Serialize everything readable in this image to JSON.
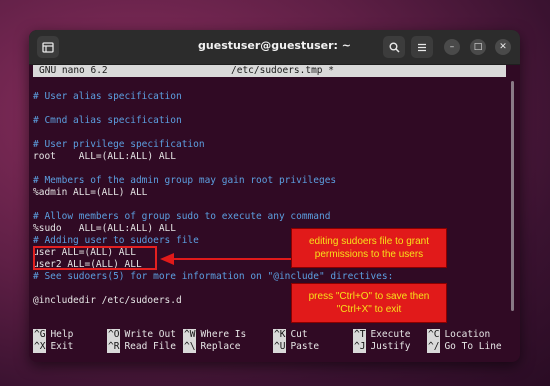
{
  "window": {
    "title": "guestuser@guestuser: ~",
    "new_tab_icon": "new-tab-icon",
    "search_icon": "search-icon",
    "menu_icon": "hamburger-menu-icon",
    "minimize_glyph": "–",
    "maximize_glyph": "□",
    "close_glyph": "✕"
  },
  "nano": {
    "version": "GNU nano 6.2",
    "filename": "/etc/sudoers.tmp *"
  },
  "lines": [
    {
      "text": "",
      "type": "plain"
    },
    {
      "text": "# User alias specification",
      "type": "comment"
    },
    {
      "text": "",
      "type": "plain"
    },
    {
      "text": "# Cmnd alias specification",
      "type": "comment"
    },
    {
      "text": "",
      "type": "plain"
    },
    {
      "text": "# User privilege specification",
      "type": "comment"
    },
    {
      "text": "root    ALL=(ALL:ALL) ALL",
      "type": "plain"
    },
    {
      "text": "",
      "type": "plain"
    },
    {
      "text": "# Members of the admin group may gain root privileges",
      "type": "comment"
    },
    {
      "text": "%admin ALL=(ALL) ALL",
      "type": "plain"
    },
    {
      "text": "",
      "type": "plain"
    },
    {
      "text": "# Allow members of group sudo to execute any command",
      "type": "comment"
    },
    {
      "text": "%sudo   ALL=(ALL:ALL) ALL",
      "type": "plain"
    },
    {
      "text": "# Adding user to sudoers file",
      "type": "comment"
    },
    {
      "text": "user ALL=(ALL) ALL",
      "type": "plain"
    },
    {
      "text": "user2 ALL=(ALL) ALL",
      "type": "plain"
    },
    {
      "text": "# See sudoers(5) for more information on \"@include\" directives:",
      "type": "comment"
    },
    {
      "text": "",
      "type": "plain"
    },
    {
      "text": "@includedir /etc/sudoers.d",
      "type": "plain"
    }
  ],
  "shortcuts": {
    "row1": [
      {
        "key": "^G",
        "label": "Help"
      },
      {
        "key": "^O",
        "label": "Write Out"
      },
      {
        "key": "^W",
        "label": "Where Is"
      },
      {
        "key": "^K",
        "label": "Cut"
      },
      {
        "key": "^T",
        "label": "Execute"
      },
      {
        "key": "^C",
        "label": "Location"
      }
    ],
    "row2": [
      {
        "key": "^X",
        "label": "Exit"
      },
      {
        "key": "^R",
        "label": "Read File"
      },
      {
        "key": "^\\",
        "label": "Replace"
      },
      {
        "key": "^U",
        "label": "Paste"
      },
      {
        "key": "^J",
        "label": "Justify"
      },
      {
        "key": "^/",
        "label": "Go To Line"
      }
    ]
  },
  "annotations": {
    "callout1_line1": "editing sudoers file to grant",
    "callout1_line2": "permissions to the users",
    "callout2_line1": "press \"Ctrl+O\" to save then",
    "callout2_line2": "\"Ctrl+X\" to exit",
    "accent_color": "#e11a1a",
    "text_color": "#f7e11a"
  }
}
